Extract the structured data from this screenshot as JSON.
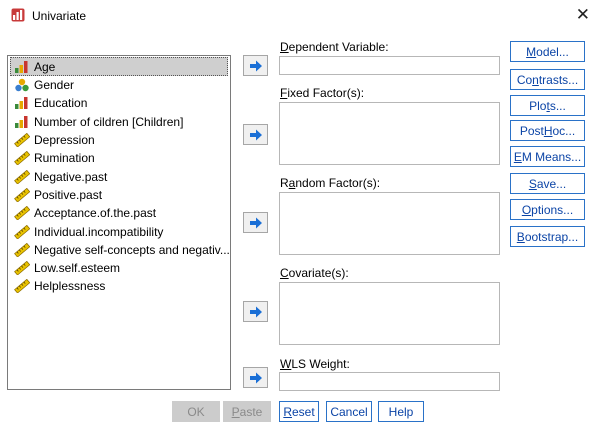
{
  "window": {
    "title": "Univariate",
    "close_glyph": "✕",
    "icon": "univariate-app-icon"
  },
  "variables": [
    {
      "label": "Age",
      "icon": "ordinal-bar-icon",
      "selected": true
    },
    {
      "label": "Gender",
      "icon": "nominal-circles-icon"
    },
    {
      "label": "Education",
      "icon": "ordinal-bar-icon"
    },
    {
      "label": "Number of cildren [Children]",
      "icon": "ordinal-bar-icon"
    },
    {
      "label": "Depression",
      "icon": "scale-ruler-icon"
    },
    {
      "label": "Rumination",
      "icon": "scale-ruler-icon"
    },
    {
      "label": "Negative.past",
      "icon": "scale-ruler-icon"
    },
    {
      "label": "Positive.past",
      "icon": "scale-ruler-icon"
    },
    {
      "label": "Acceptance.of.the.past",
      "icon": "scale-ruler-icon"
    },
    {
      "label": "Individual.incompatibility",
      "icon": "scale-ruler-icon"
    },
    {
      "label": "Negative self-concepts and negativ...",
      "icon": "scale-ruler-icon"
    },
    {
      "label": "Low.self.esteem",
      "icon": "scale-ruler-icon"
    },
    {
      "label": "Helplessness",
      "icon": "scale-ruler-icon"
    }
  ],
  "fields": {
    "dependent": {
      "pre": "",
      "key": "D",
      "post": "ependent Variable:"
    },
    "fixed": {
      "pre": "",
      "key": "F",
      "post": "ixed Factor(s):"
    },
    "random": {
      "pre": "R",
      "key": "a",
      "post": "ndom Factor(s):"
    },
    "covariate": {
      "pre": "",
      "key": "C",
      "post": "ovariate(s):"
    },
    "wls": {
      "pre": "",
      "key": "W",
      "post": "LS Weight:"
    }
  },
  "side_buttons": [
    {
      "pre": "",
      "key": "M",
      "post": "odel..."
    },
    {
      "pre": "Co",
      "key": "n",
      "post": "trasts..."
    },
    {
      "pre": "Plo",
      "key": "t",
      "post": "s..."
    },
    {
      "pre": "Post ",
      "key": "H",
      "post": "oc..."
    },
    {
      "pre": "",
      "key": "E",
      "post": "M Means..."
    },
    {
      "pre": "",
      "key": "S",
      "post": "ave..."
    },
    {
      "pre": "",
      "key": "O",
      "post": "ptions..."
    },
    {
      "pre": "",
      "key": "B",
      "post": "ootstrap..."
    }
  ],
  "bottom_buttons": {
    "ok": {
      "pre": "OK",
      "key": "",
      "post": ""
    },
    "paste": {
      "pre": "",
      "key": "P",
      "post": "aste"
    },
    "reset": {
      "pre": "",
      "key": "R",
      "post": "eset"
    },
    "cancel": {
      "pre": "Cancel",
      "key": "",
      "post": ""
    },
    "help": {
      "pre": "Help",
      "key": "",
      "post": ""
    }
  },
  "arrow_icon": "move-right-arrow-icon",
  "colors": {
    "accent_blue": "#1a6fd6",
    "button_border": "#2a72c8",
    "disabled_bg": "#cccccc"
  }
}
